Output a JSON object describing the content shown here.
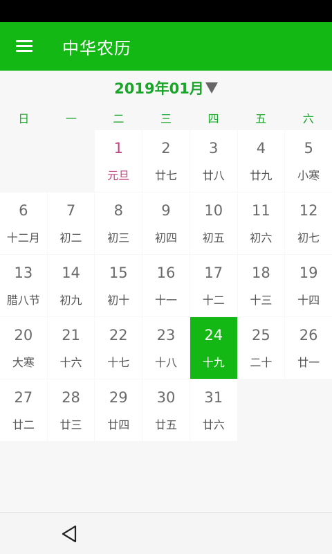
{
  "app": {
    "title": "中华农历"
  },
  "calendar": {
    "month_label": "2019年01月",
    "weekdays": [
      "日",
      "一",
      "二",
      "三",
      "四",
      "五",
      "六"
    ],
    "days": [
      {
        "day": "1",
        "lunar": "元旦",
        "state": "holiday"
      },
      {
        "day": "2",
        "lunar": "廿七"
      },
      {
        "day": "3",
        "lunar": "廿八"
      },
      {
        "day": "4",
        "lunar": "廿九"
      },
      {
        "day": "5",
        "lunar": "小寒"
      },
      {
        "day": "6",
        "lunar": "十二月"
      },
      {
        "day": "7",
        "lunar": "初二"
      },
      {
        "day": "8",
        "lunar": "初三"
      },
      {
        "day": "9",
        "lunar": "初四"
      },
      {
        "day": "10",
        "lunar": "初五"
      },
      {
        "day": "11",
        "lunar": "初六"
      },
      {
        "day": "12",
        "lunar": "初七"
      },
      {
        "day": "13",
        "lunar": "腊八节"
      },
      {
        "day": "14",
        "lunar": "初九"
      },
      {
        "day": "15",
        "lunar": "初十"
      },
      {
        "day": "16",
        "lunar": "十一"
      },
      {
        "day": "17",
        "lunar": "十二"
      },
      {
        "day": "18",
        "lunar": "十三"
      },
      {
        "day": "19",
        "lunar": "十四"
      },
      {
        "day": "20",
        "lunar": "大寒"
      },
      {
        "day": "21",
        "lunar": "十六"
      },
      {
        "day": "22",
        "lunar": "十七"
      },
      {
        "day": "23",
        "lunar": "十八"
      },
      {
        "day": "24",
        "lunar": "十九",
        "state": "today"
      },
      {
        "day": "25",
        "lunar": "二十"
      },
      {
        "day": "26",
        "lunar": "廿一"
      },
      {
        "day": "27",
        "lunar": "廿二"
      },
      {
        "day": "28",
        "lunar": "廿三"
      },
      {
        "day": "29",
        "lunar": "廿四"
      },
      {
        "day": "30",
        "lunar": "廿五"
      },
      {
        "day": "31",
        "lunar": "廿六"
      }
    ]
  },
  "icons": {
    "menu": "hamburger-menu-icon",
    "dropdown": "triangle-down-icon",
    "back": "back-triangle-icon"
  },
  "colors": {
    "primary": "#14b814",
    "accent_text": "#1aa52a",
    "holiday": "#c2407e",
    "status_bar": "#000000"
  }
}
